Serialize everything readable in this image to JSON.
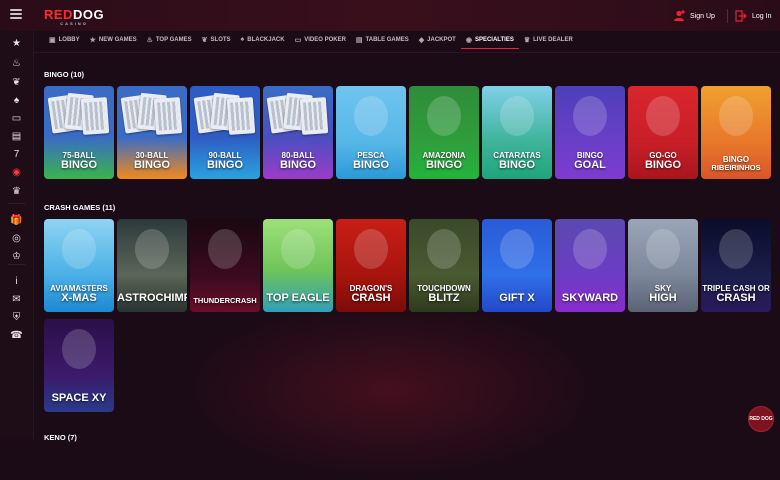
{
  "brand": {
    "logo_red": "RED",
    "logo_white": "DOG",
    "logo_sub": "CASINO"
  },
  "header": {
    "signup": "Sign Up",
    "login": "Log In"
  },
  "nav": {
    "tabs": [
      {
        "label": "LOBBY",
        "icon": "lobby-icon",
        "glyph": "▣"
      },
      {
        "label": "NEW GAMES",
        "icon": "star-icon",
        "glyph": "★"
      },
      {
        "label": "TOP GAMES",
        "icon": "flame-icon",
        "glyph": "♨"
      },
      {
        "label": "SLOTS",
        "icon": "cherry-icon",
        "glyph": "❦"
      },
      {
        "label": "BLACKJACK",
        "icon": "spade-icon",
        "glyph": "♠"
      },
      {
        "label": "VIDEO POKER",
        "icon": "monitor-icon",
        "glyph": "▭"
      },
      {
        "label": "TABLE GAMES",
        "icon": "cards-icon",
        "glyph": "▤"
      },
      {
        "label": "JACKPOT",
        "icon": "jackpot-icon",
        "glyph": "◆"
      },
      {
        "label": "SPECIALTIES",
        "icon": "chip-icon",
        "glyph": "◉"
      },
      {
        "label": "LIVE DEALER",
        "icon": "dealer-icon",
        "glyph": "♛"
      }
    ],
    "active": "SPECIALTIES"
  },
  "sections": {
    "bingo": {
      "title": "BINGO (10)",
      "games": [
        {
          "l1": "75-BALL",
          "l2": "BINGO",
          "bg": "linear-gradient(180deg,#3a6cc6 0%,#3a6cc6 55%,#39b44a 100%)"
        },
        {
          "l1": "30-BALL",
          "l2": "BINGO",
          "bg": "linear-gradient(180deg,#3a6cc6 0%,#3a6cc6 55%,#f08a1c 100%)"
        },
        {
          "l1": "90-BALL",
          "l2": "BINGO",
          "bg": "linear-gradient(180deg,#2f5cc4 0%,#2f5cc4 55%,#2aa3e0 100%)"
        },
        {
          "l1": "80-BALL",
          "l2": "BINGO",
          "bg": "linear-gradient(180deg,#3a6cc6 0%,#4a4fc0 55%,#9a3cc8 100%)"
        },
        {
          "l1": "PESCA",
          "l2": "BINGO",
          "bg": "linear-gradient(180deg,#6fc4ef 0%,#58b7e8 60%,#2a9ad8 100%)"
        },
        {
          "l1": "AMAZONIA",
          "l2": "BINGO",
          "bg": "linear-gradient(180deg,#2f8c3a 0%,#2f9e3c 60%,#22b43c 100%)"
        },
        {
          "l1": "CATARATAS",
          "l2": "BINGO",
          "bg": "linear-gradient(180deg,#7fd0e8 0%,#3fb39a 60%,#1fa57a 100%)"
        },
        {
          "l1": "BINGO",
          "l2": "GOAL",
          "bg": "linear-gradient(180deg,#4d3fb8 0%,#6a3fc8 60%,#7d3bd0 100%)"
        },
        {
          "l1": "GO-GO",
          "l2": "BINGO",
          "bg": "linear-gradient(180deg,#d9262c 0%,#c81f28 60%,#a9151e 100%)"
        },
        {
          "l1": "BINGO",
          "l2": "RIBEIRINHOS",
          "bg": "linear-gradient(180deg,#f0a030 0%,#e8782a 60%,#d8552a 100%)"
        }
      ]
    },
    "crash": {
      "title": "CRASH GAMES (11)",
      "games": [
        {
          "l1": "AVIAMASTERS",
          "l2": "X-MAS",
          "bg": "linear-gradient(180deg,#8fd4f2 0%,#4ab0e6 60%,#1c88d0 100%)"
        },
        {
          "l1": "",
          "l2": "ASTROCHIMP",
          "bg": "linear-gradient(180deg,#2c3a3c 0%,#5a6658 60%,#2a3330 100%)"
        },
        {
          "l1": "",
          "l2": "THUNDERCRASH",
          "bg": "linear-gradient(180deg,#1a0810 0%,#3a0a1e 60%,#6a0f2a 100%)"
        },
        {
          "l1": "",
          "l2": "TOP EAGLE",
          "bg": "linear-gradient(180deg,#9ee07a 0%,#6fc45a 55%,#2f9fb8 100%)"
        },
        {
          "l1": "DRAGON'S",
          "l2": "CRASH",
          "bg": "linear-gradient(180deg,#c81e16 0%,#a8140e 60%,#7a0c0a 100%)"
        },
        {
          "l1": "TOUCHDOWN",
          "l2": "BLITZ",
          "bg": "linear-gradient(180deg,#3a4a2a 0%,#4a5a32 60%,#2e3a1e 100%)"
        },
        {
          "l1": "",
          "l2": "GIFT X",
          "bg": "linear-gradient(180deg,#2a5ad8 0%,#2f70e8 60%,#2448c8 100%)"
        },
        {
          "l1": "",
          "l2": "SKYWARD",
          "bg": "linear-gradient(180deg,#5a4ab0 0%,#6c3cc4 60%,#8a2ccc 100%)"
        },
        {
          "l1": "SKY",
          "l2": "HIGH",
          "bg": "linear-gradient(180deg,#9aa6b8 0%,#7c879a 60%,#5a6374 100%)"
        },
        {
          "l1": "TRIPLE CASH OR",
          "l2": "CRASH",
          "bg": "linear-gradient(180deg,#0a0c2a 0%,#1a1e4a 60%,#2a1a5a 100%)"
        },
        {
          "l1": "",
          "l2": "SPACE XY",
          "bg": "linear-gradient(180deg,#2a0f4a 0%,#3c1a6a 60%,#2a3a8a 100%)"
        }
      ]
    },
    "keno": {
      "title": "KENO (7)"
    }
  },
  "sidebar": {
    "icons": [
      "star-icon",
      "flame-icon",
      "cherry-icon",
      "spade-icon",
      "monitor-icon",
      "cards-icon",
      "jackpot-icon",
      "chip-icon",
      "dealer-icon",
      "gift-icon",
      "target-icon",
      "trophy-icon",
      "info-icon",
      "chat-icon",
      "lock-icon",
      "support-icon"
    ],
    "glyphs": [
      "★",
      "♨",
      "❦",
      "♠",
      "▭",
      "▤",
      "7",
      "◉",
      "♛",
      "🎁",
      "◎",
      "♔",
      "i",
      "✉",
      "⛨",
      "☎"
    ]
  },
  "chat": {
    "label": "RED DOG"
  }
}
